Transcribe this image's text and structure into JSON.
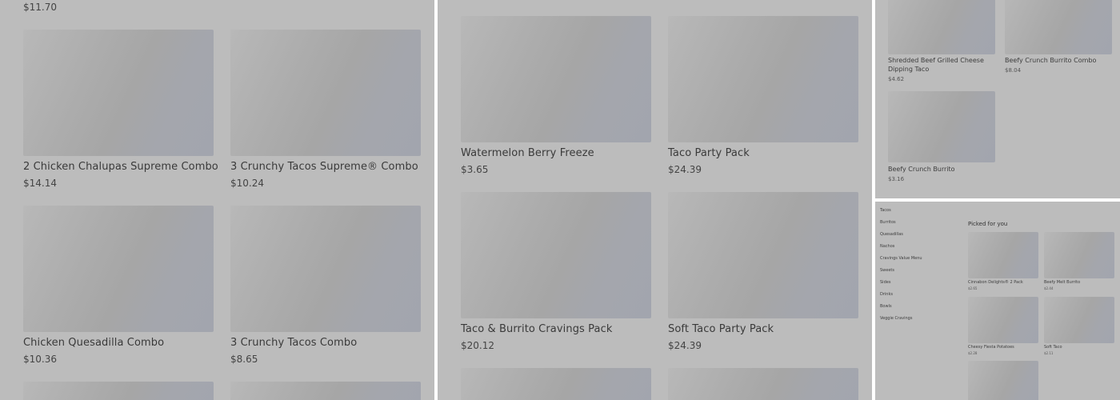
{
  "panel1": {
    "top_price": "$11.70",
    "items": [
      {
        "name": "2 Chicken Chalupas Supreme Combo",
        "price": "$14.14"
      },
      {
        "name": "3 Crunchy Tacos Supreme® Combo",
        "price": "$10.24"
      },
      {
        "name": "Chicken Quesadilla Combo",
        "price": "$10.36"
      },
      {
        "name": "3 Crunchy Tacos Combo",
        "price": "$8.65"
      }
    ]
  },
  "panel2": {
    "items": [
      {
        "name": "Watermelon Berry Freeze",
        "price": "$3.65"
      },
      {
        "name": "Taco Party Pack",
        "price": "$24.39"
      },
      {
        "name": "Taco & Burrito Cravings Pack",
        "price": "$20.12"
      },
      {
        "name": "Soft Taco Party Pack",
        "price": "$24.39"
      }
    ]
  },
  "panel3": {
    "items": [
      {
        "name": "Shredded Beef Grilled Cheese Dipping Taco",
        "price": "$4.62"
      },
      {
        "name": "Beefy Crunch Burrito Combo",
        "price": "$8.04"
      },
      {
        "name": "Beefy Crunch Burrito",
        "price": "$3.16"
      }
    ]
  },
  "panel4": {
    "categories": [
      "Tacos",
      "Burritos",
      "Quesadillas",
      "Nachos",
      "Cravings Value Menu",
      "Sweets",
      "Sides",
      "Drinks",
      "Bowls",
      "Veggie Cravings"
    ],
    "heading": "Picked for you",
    "items": [
      {
        "name": "Cinnabon Delights® 2 Pack",
        "price": "$2.65"
      },
      {
        "name": "Beefy Melt Burrito",
        "price": "$2.44"
      },
      {
        "name": "Cheesy Fiesta Potatoes",
        "price": "$2.28"
      },
      {
        "name": "Soft Taco",
        "price": "$2.11"
      }
    ]
  }
}
